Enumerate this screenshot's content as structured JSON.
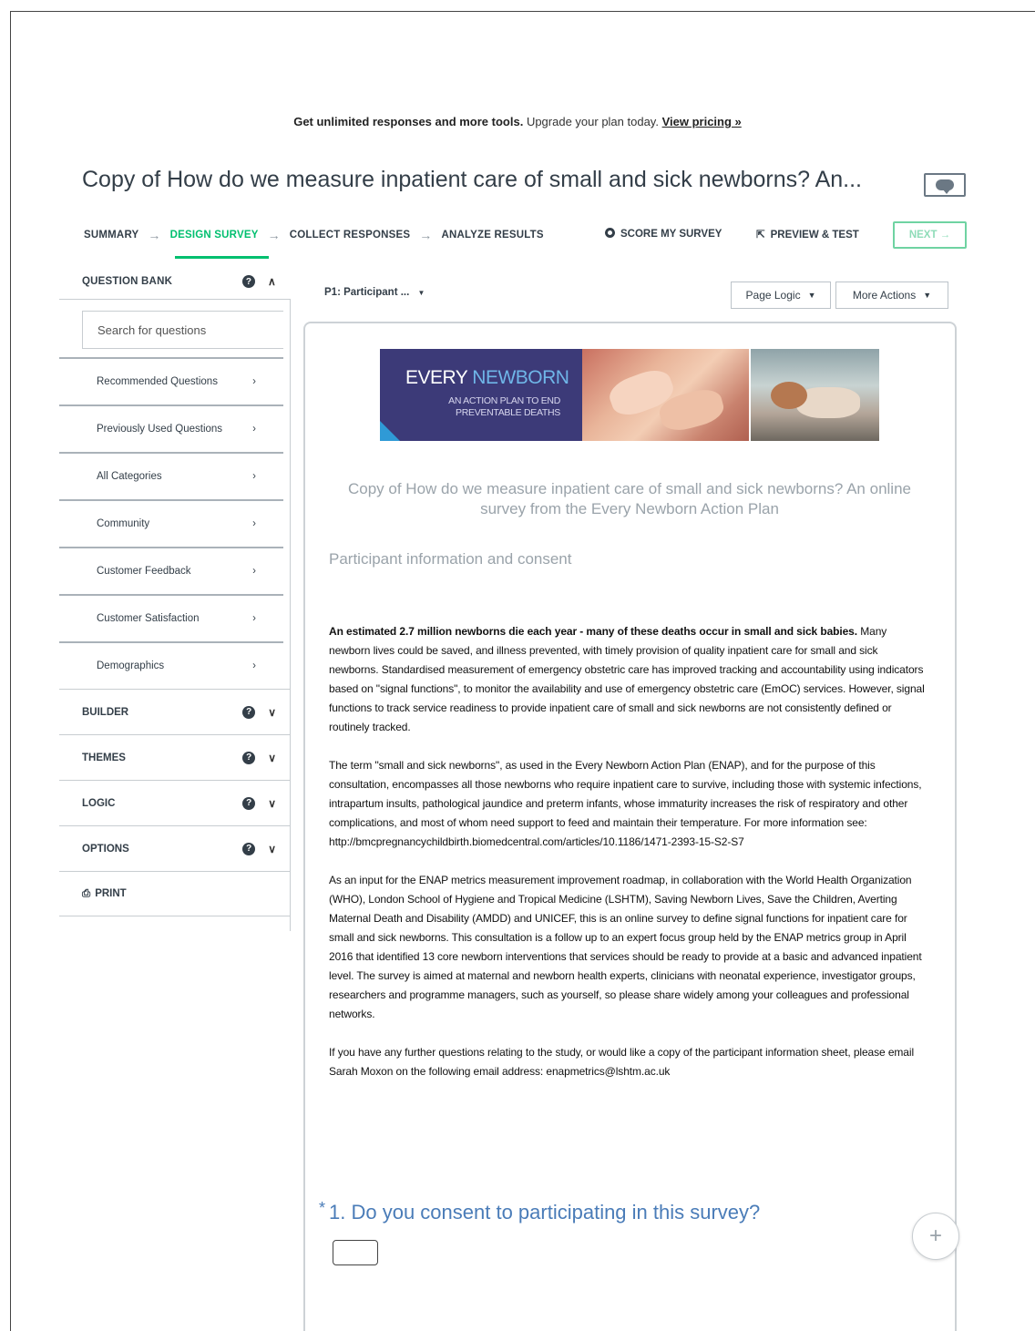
{
  "banner": {
    "bold": "Get unlimited responses and more tools.",
    "text": "Upgrade your plan today.",
    "link": "View pricing »"
  },
  "survey_title": "Copy of How do we measure inpatient care of small and sick newborns? An...",
  "steps": [
    {
      "label": "SUMMARY"
    },
    {
      "label": "DESIGN SURVEY"
    },
    {
      "label": "COLLECT RESPONSES"
    },
    {
      "label": "ANALYZE RESULTS"
    }
  ],
  "arrow": "→",
  "actions": {
    "score": "SCORE MY SURVEY",
    "preview": "PREVIEW & TEST",
    "next": "NEXT →"
  },
  "sidebar": {
    "question_bank": "QUESTION BANK",
    "search_placeholder": "Search for questions",
    "categories": [
      "Recommended Questions",
      "Previously Used Questions",
      "All Categories",
      "Community",
      "Customer Feedback",
      "Customer Satisfaction",
      "Demographics"
    ],
    "sections": [
      "BUILDER",
      "THEMES",
      "LOGIC",
      "OPTIONS"
    ],
    "print": "PRINT"
  },
  "toolbar": {
    "page_select": "P1: Participant ...",
    "page_logic": "Page Logic",
    "more_actions": "More Actions"
  },
  "banner_image": {
    "every": "EVERY ",
    "newborn": "NEWBORN",
    "sub1": "AN ACTION PLAN TO END",
    "sub2": "PREVENTABLE DEATHS"
  },
  "survey": {
    "heading": "Copy of How do we measure inpatient care of small and sick newborns? An online survey from the Every Newborn Action Plan",
    "page_title": "Participant information and consent",
    "p1_bold": "An estimated 2.7 million newborns die each year - many of these deaths occur in small and sick babies.",
    "p1_rest": " Many newborn lives could be saved, and illness prevented, with timely provision of quality inpatient care for small and sick newborns. Standardised measurement of emergency obstetric care has improved tracking and accountability using indicators based on \"signal functions\", to monitor the availability and use of emergency obstetric care (EmOC) services. However, signal functions to track service readiness to provide inpatient care of small and sick newborns are not consistently defined or routinely tracked.",
    "p2": "The term \"small and sick newborns\", as used in the Every Newborn Action Plan (ENAP), and for the purpose of this consultation, encompasses all those newborns who require inpatient care to survive, including those with systemic infections, intrapartum insults, pathological jaundice and preterm infants, whose immaturity increases the risk of respiratory and other complications, and most of whom need support to feed and maintain their temperature. For more information see: http://bmcpregnancychildbirth.biomedcentral.com/articles/10.1186/1471-2393-15-S2-S7",
    "p3": "As an input for the ENAP metrics measurement improvement roadmap, in collaboration with the World Health Organization (WHO), London School of Hygiene and Tropical Medicine (LSHTM), Saving Newborn Lives, Save the Children, Averting Maternal Death and Disability (AMDD) and UNICEF, this is an online survey to define signal functions for inpatient care for small and sick newborns. This consultation is a follow up to an expert focus group held by the ENAP metrics group in April 2016 that identified 13 core newborn interventions that services should be ready to provide at a basic and advanced inpatient level. The survey is aimed at maternal and newborn health experts, clinicians with neonatal experience, investigator groups, researchers and programme managers, such as yourself, so please share widely among your colleagues and professional networks.",
    "p4": "If you have any further questions relating to the study, or would like a copy of the participant information sheet, please email Sarah Moxon on the following email address: enapmetrics@lshtm.ac.uk",
    "question_star": "*",
    "question": "1. Do you consent to participating in this survey?"
  },
  "colors": {
    "accent": "#00bf6f",
    "question": "#4a7cb8",
    "text": "#333e48"
  },
  "icons": {
    "help": "?",
    "chevron_up": "∧",
    "chevron_down": "∨",
    "chevron_right": "›",
    "caret": "▼",
    "plus": "+"
  }
}
